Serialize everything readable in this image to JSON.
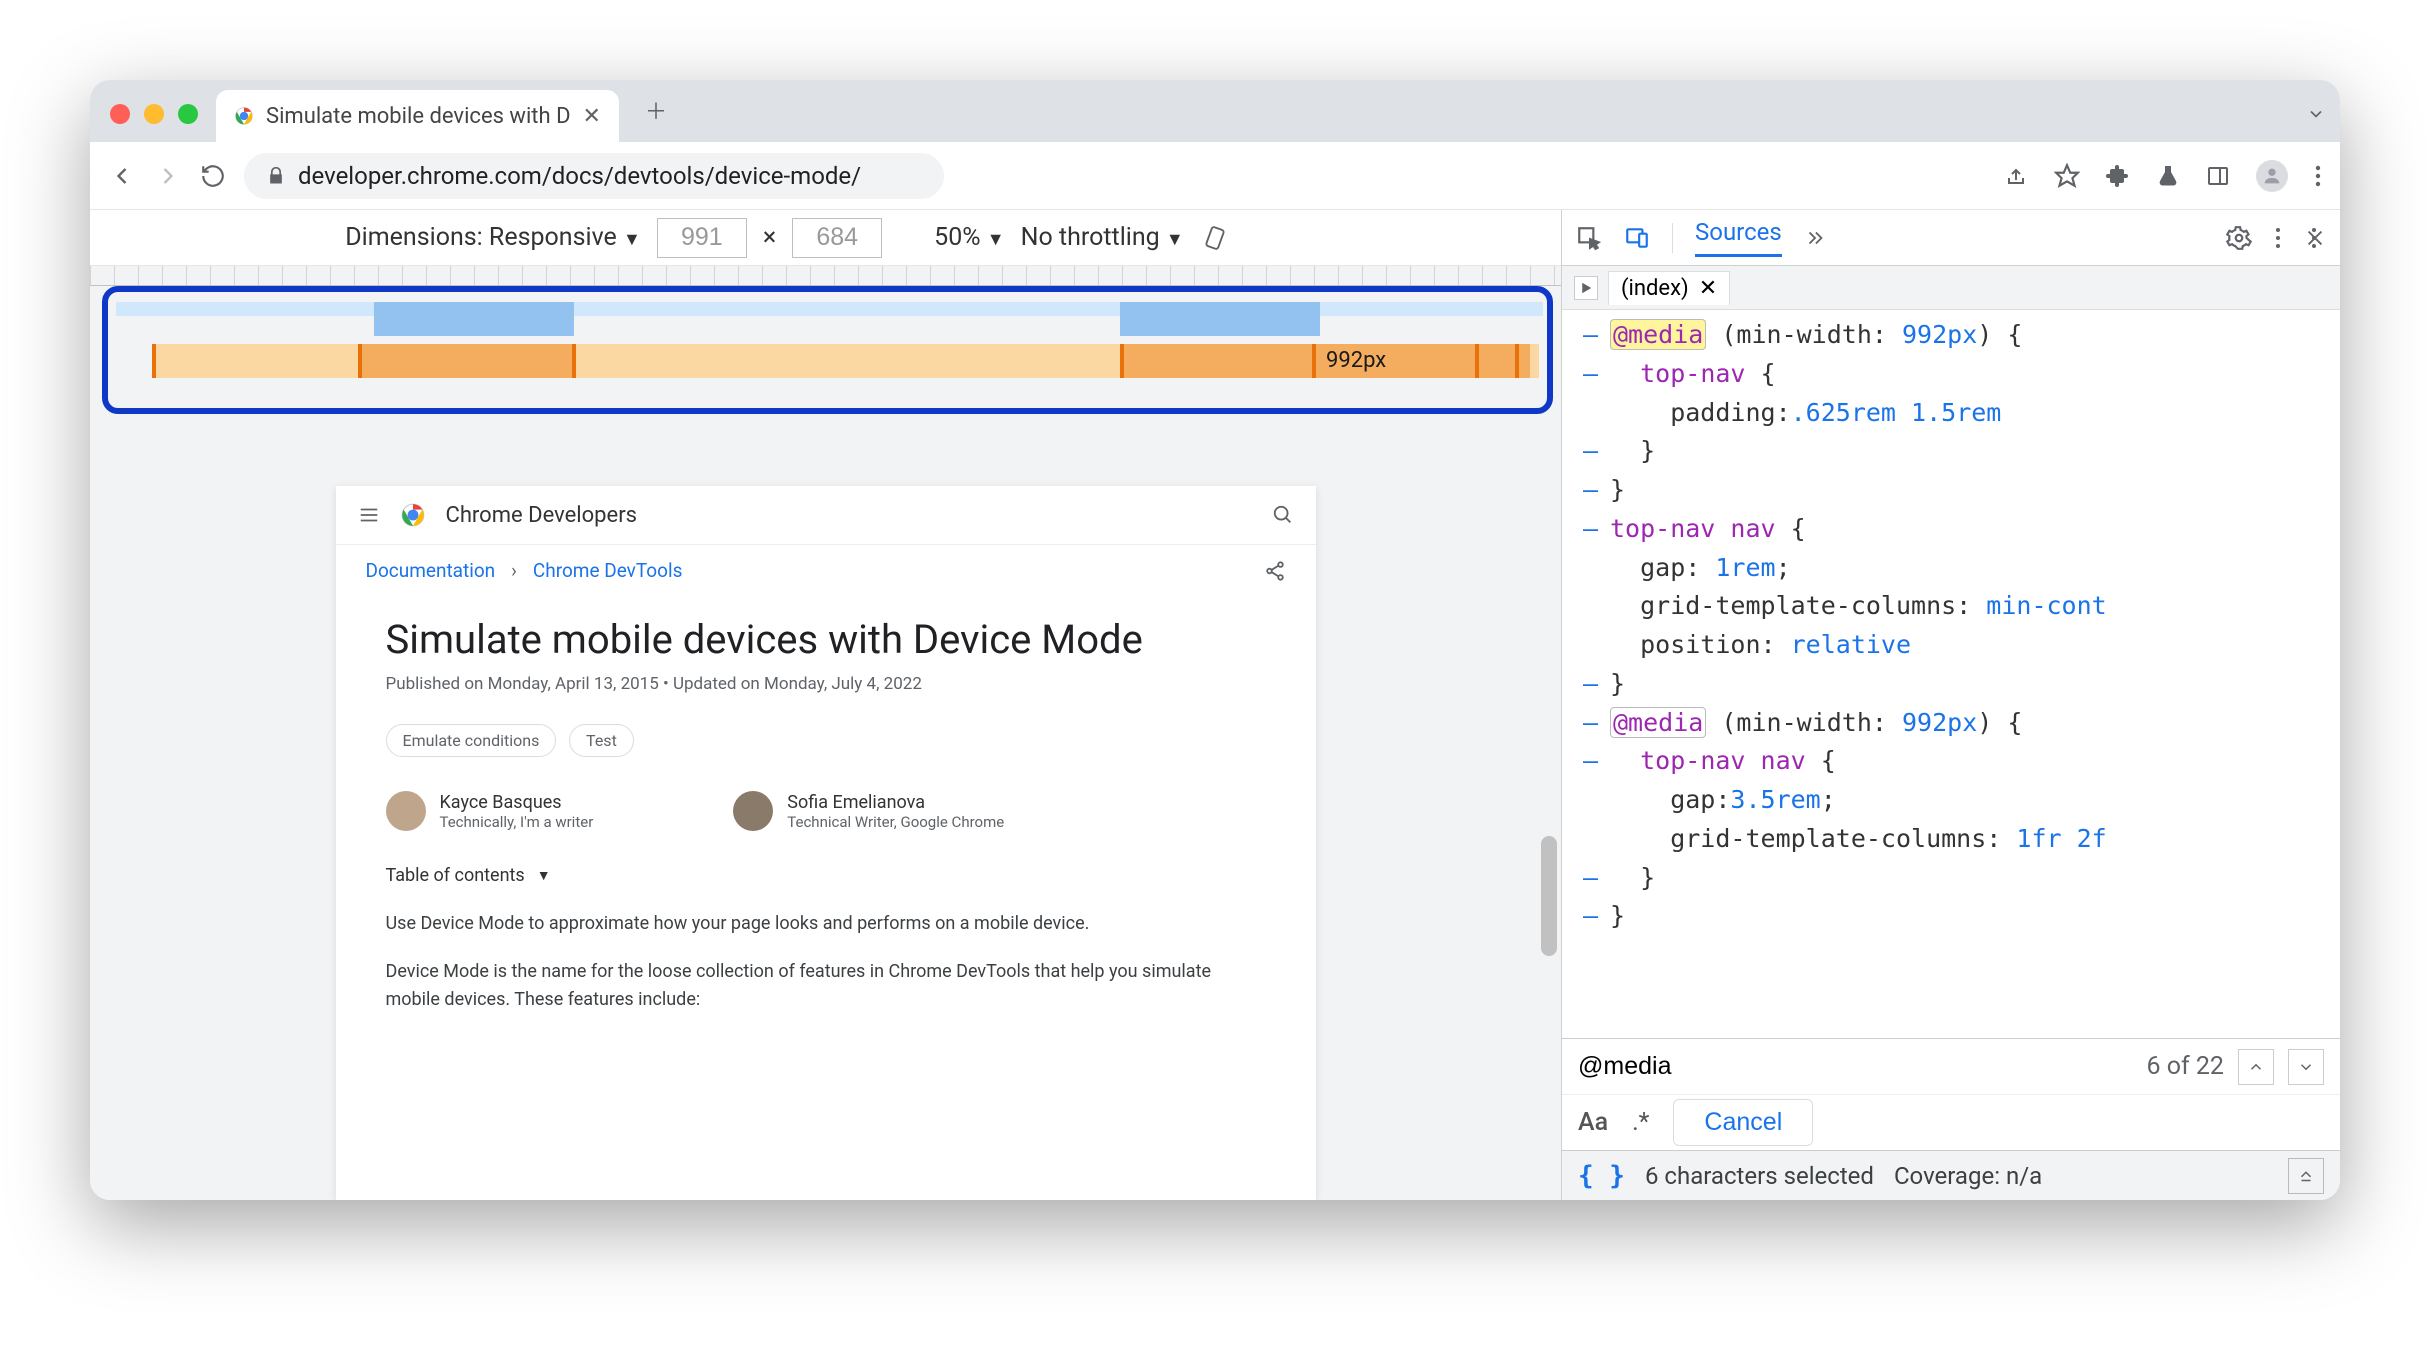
{
  "browser": {
    "tab_title": "Simulate mobile devices with D",
    "url": "developer.chrome.com/docs/devtools/device-mode/"
  },
  "device_toolbar": {
    "dimensions_label": "Dimensions: Responsive",
    "width": "991",
    "height": "684",
    "separator": "×",
    "zoom": "50%",
    "throttling": "No throttling",
    "breakpoint_label": "992px"
  },
  "page": {
    "site_name": "Chrome Developers",
    "breadcrumbs": [
      "Documentation",
      "Chrome DevTools"
    ],
    "title": "Simulate mobile devices with Device Mode",
    "meta": "Published on Monday, April 13, 2015 • Updated on Monday, July 4, 2022",
    "chips": [
      "Emulate conditions",
      "Test"
    ],
    "authors": [
      {
        "name": "Kayce Basques",
        "sub": "Technically, I'm a writer"
      },
      {
        "name": "Sofia Emelianova",
        "sub": "Technical Writer, Google Chrome"
      }
    ],
    "toc": "Table of contents",
    "p1": "Use Device Mode to approximate how your page looks and performs on a mobile device.",
    "p2": "Device Mode is the name for the loose collection of features in Chrome DevTools that help you simulate mobile devices. These features include:"
  },
  "devtools": {
    "active_panel": "Sources",
    "file_tab": "(index)",
    "code_lines": [
      {
        "g": "–",
        "html": "<span class='hl'><span class='box-media'>@media</span></span> (min-width: <span class='num'>992px</span>) {"
      },
      {
        "g": "–",
        "html": "  <span class='sel'>top-nav</span> {"
      },
      {
        "g": "",
        "html": "    padding:<span class='num'>.625rem</span> <span class='num'>1.5rem</span>"
      },
      {
        "g": "–",
        "html": "  }"
      },
      {
        "g": "–",
        "html": "}"
      },
      {
        "g": "",
        "html": ""
      },
      {
        "g": "–",
        "html": "<span class='sel'>top-nav nav</span> {"
      },
      {
        "g": "",
        "html": "  gap: <span class='num'>1rem</span>;"
      },
      {
        "g": "",
        "html": "  grid-template-columns: <span class='num'>min-cont</span>"
      },
      {
        "g": "",
        "html": "  position: <span class='num'>relative</span>"
      },
      {
        "g": "–",
        "html": "}"
      },
      {
        "g": "",
        "html": ""
      },
      {
        "g": "–",
        "html": "<span class='box-media'>@media</span> (min-width: <span class='num'>992px</span>) {"
      },
      {
        "g": "–",
        "html": "  <span class='sel'>top-nav nav</span> {"
      },
      {
        "g": "",
        "html": "    gap:<span class='num'>3.5rem</span>;"
      },
      {
        "g": "",
        "html": "    grid-template-columns: <span class='num'>1fr</span> <span class='num'>2f</span>"
      },
      {
        "g": "–",
        "html": "  }"
      },
      {
        "g": "–",
        "html": "}"
      }
    ],
    "search": {
      "query": "@media",
      "result": "6 of 22",
      "case_label": "Aa",
      "regex_label": ".*",
      "cancel": "Cancel"
    },
    "status": {
      "selection": "6 characters selected",
      "coverage": "Coverage: n/a"
    }
  }
}
